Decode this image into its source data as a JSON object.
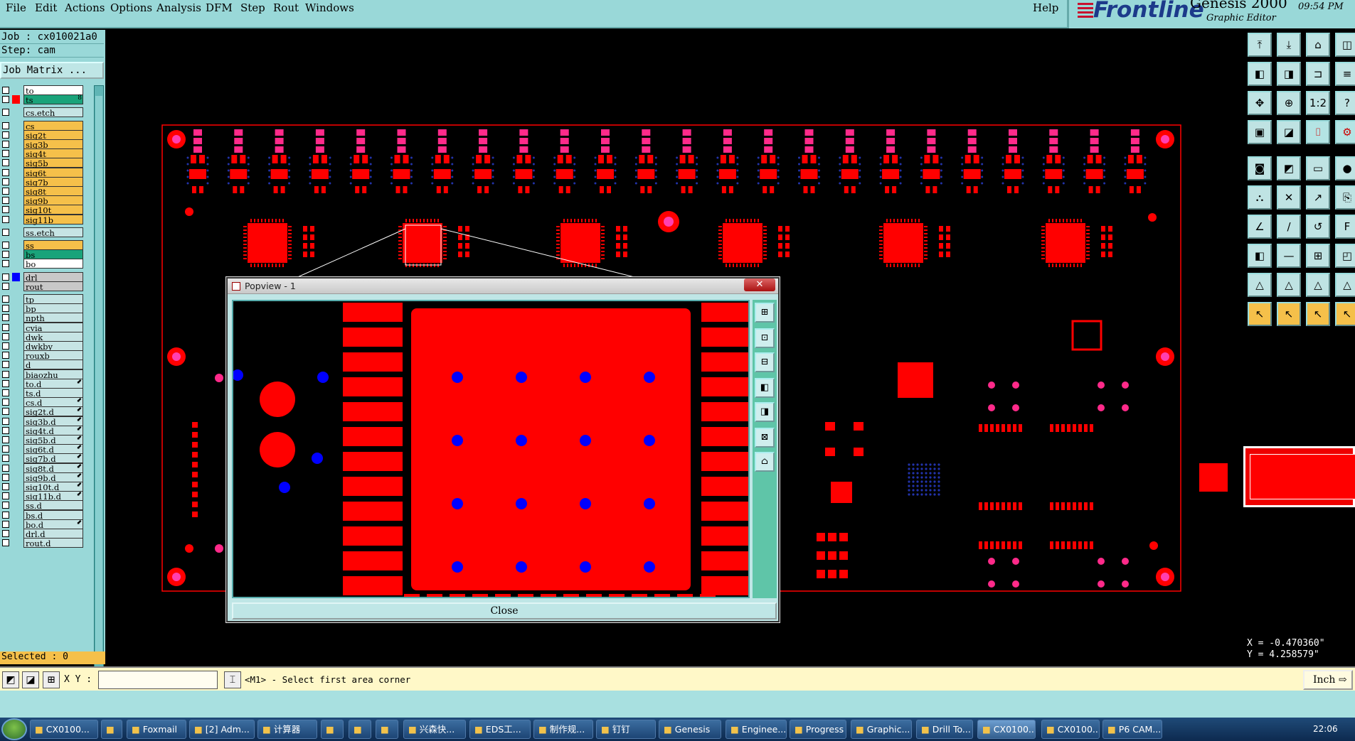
{
  "menu": [
    "File",
    "Edit",
    "Actions",
    "Options",
    "Analysis",
    "DFM",
    "Step",
    "Rout",
    "Windows"
  ],
  "help": "Help",
  "brand": {
    "logo": "Frontline",
    "title": "Genesis 2000",
    "subtitle": "Graphic Editor",
    "time": "09:54 PM"
  },
  "job": {
    "label": "Job : cx010021a0",
    "step": "Step: cam",
    "matrix_button": "Job Matrix ..."
  },
  "layers": [
    {
      "name": "to",
      "color": "#ffffff",
      "dot": "",
      "sub": ""
    },
    {
      "name": "ts",
      "color": "#1aa37a",
      "dot": "#ff0000",
      "sub": "8"
    },
    {
      "name": "cs.etch",
      "color": "#c6e4e4",
      "dot": "",
      "sub": ""
    },
    {
      "name": "cs",
      "color": "#f5c04a",
      "dot": "",
      "sub": ""
    },
    {
      "name": "sig2t",
      "color": "#f5c04a",
      "dot": "",
      "sub": ""
    },
    {
      "name": "sig3b",
      "color": "#f5c04a",
      "dot": "",
      "sub": ""
    },
    {
      "name": "sig4t",
      "color": "#f5c04a",
      "dot": "",
      "sub": ""
    },
    {
      "name": "sig5b",
      "color": "#f5c04a",
      "dot": "",
      "sub": ""
    },
    {
      "name": "sig6t",
      "color": "#f5c04a",
      "dot": "",
      "sub": ""
    },
    {
      "name": "sig7b",
      "color": "#f5c04a",
      "dot": "",
      "sub": ""
    },
    {
      "name": "sig8t",
      "color": "#f5c04a",
      "dot": "",
      "sub": ""
    },
    {
      "name": "sig9b",
      "color": "#f5c04a",
      "dot": "",
      "sub": ""
    },
    {
      "name": "sig10t",
      "color": "#f5c04a",
      "dot": "",
      "sub": ""
    },
    {
      "name": "sig11b",
      "color": "#f5c04a",
      "dot": "",
      "sub": ""
    },
    {
      "name": "ss.etch",
      "color": "#c6e4e4",
      "dot": "",
      "sub": ""
    },
    {
      "name": "ss",
      "color": "#f5c04a",
      "dot": "",
      "sub": ""
    },
    {
      "name": "bs",
      "color": "#1aa37a",
      "dot": "",
      "sub": ""
    },
    {
      "name": "bo",
      "color": "#ffffff",
      "dot": "",
      "sub": ""
    },
    {
      "name": "drl",
      "color": "#c8c8c8",
      "dot": "#0000ff",
      "sub": ""
    },
    {
      "name": "rout",
      "color": "#c8c8c8",
      "dot": "",
      "sub": ""
    },
    {
      "name": "tp",
      "color": "#c6e4e4",
      "dot": "",
      "sub": ""
    },
    {
      "name": "bp",
      "color": "#c6e4e4",
      "dot": "",
      "sub": ""
    },
    {
      "name": "npth",
      "color": "#c6e4e4",
      "dot": "",
      "sub": ""
    },
    {
      "name": "cvia",
      "color": "#c6e4e4",
      "dot": "",
      "sub": ""
    },
    {
      "name": "dwk",
      "color": "#c6e4e4",
      "dot": "",
      "sub": ""
    },
    {
      "name": "dwkby",
      "color": "#c6e4e4",
      "dot": "",
      "sub": ""
    },
    {
      "name": "rouxb",
      "color": "#c6e4e4",
      "dot": "",
      "sub": ""
    },
    {
      "name": "d",
      "color": "#c6e4e4",
      "dot": "",
      "sub": ""
    },
    {
      "name": "biaozhu",
      "color": "#c6e4e4",
      "dot": "",
      "sub": ""
    },
    {
      "name": "to.d",
      "color": "#c6e4e4",
      "dot": "",
      "sub": "⬋"
    },
    {
      "name": "ts.d",
      "color": "#c6e4e4",
      "dot": "",
      "sub": ""
    },
    {
      "name": "cs.d",
      "color": "#c6e4e4",
      "dot": "",
      "sub": "⬋"
    },
    {
      "name": "sig2t.d",
      "color": "#c6e4e4",
      "dot": "",
      "sub": "⬋"
    },
    {
      "name": "sig3b.d",
      "color": "#c6e4e4",
      "dot": "",
      "sub": "⬋"
    },
    {
      "name": "sig4t.d",
      "color": "#c6e4e4",
      "dot": "",
      "sub": "⬋"
    },
    {
      "name": "sig5b.d",
      "color": "#c6e4e4",
      "dot": "",
      "sub": "⬋"
    },
    {
      "name": "sig6t.d",
      "color": "#c6e4e4",
      "dot": "",
      "sub": "⬋"
    },
    {
      "name": "sig7b.d",
      "color": "#c6e4e4",
      "dot": "",
      "sub": "⬋"
    },
    {
      "name": "sig8t.d",
      "color": "#c6e4e4",
      "dot": "",
      "sub": "⬋"
    },
    {
      "name": "sig9b.d",
      "color": "#c6e4e4",
      "dot": "",
      "sub": "⬋"
    },
    {
      "name": "sig10t.d",
      "color": "#c6e4e4",
      "dot": "",
      "sub": "⬋"
    },
    {
      "name": "sig11b.d",
      "color": "#c6e4e4",
      "dot": "",
      "sub": "⬋"
    },
    {
      "name": "ss.d",
      "color": "#c6e4e4",
      "dot": "",
      "sub": ""
    },
    {
      "name": "bs.d",
      "color": "#c6e4e4",
      "dot": "",
      "sub": ""
    },
    {
      "name": "bo.d",
      "color": "#c6e4e4",
      "dot": "",
      "sub": "⬋"
    },
    {
      "name": "drl.d",
      "color": "#c6e4e4",
      "dot": "",
      "sub": ""
    },
    {
      "name": "rout.d",
      "color": "#c6e4e4",
      "dot": "",
      "sub": ""
    }
  ],
  "selected": "Selected : 0",
  "coords": {
    "x": "X = -0.470360\"",
    "y": "Y = 4.258579\""
  },
  "status": {
    "xy_label": "X Y :",
    "xy_value": "",
    "prompt": "<M1> - Select first area corner",
    "units": "Inch"
  },
  "popview": {
    "title": "Popview - 1",
    "close_x": "✕",
    "close_button": "Close"
  },
  "taskbar": [
    {
      "label": "CX0100...",
      "icon": "ie-icon"
    },
    {
      "label": "",
      "icon": "folder-icon"
    },
    {
      "label": "Foxmail",
      "icon": "foxmail-icon"
    },
    {
      "label": "[2] Adm...",
      "icon": "admin-icon"
    },
    {
      "label": "计算器",
      "icon": "calculator-icon"
    },
    {
      "label": "",
      "icon": "app-icon"
    },
    {
      "label": "",
      "icon": "app-icon"
    },
    {
      "label": "",
      "icon": "app-icon"
    },
    {
      "label": "兴森快...",
      "icon": "star-icon"
    },
    {
      "label": "EDS工...",
      "icon": "eds-icon"
    },
    {
      "label": "制作规...",
      "icon": "doc-icon"
    },
    {
      "label": "钉钉",
      "icon": "dingtalk-icon"
    },
    {
      "label": "Genesis",
      "icon": "genesis-icon"
    },
    {
      "label": "Enginee...",
      "icon": "window-icon"
    },
    {
      "label": "Progress",
      "icon": "window-icon"
    },
    {
      "label": "Graphic...",
      "icon": "window-icon"
    },
    {
      "label": "Drill To...",
      "icon": "window-icon"
    },
    {
      "label": "CX0100...",
      "icon": "window-icon"
    },
    {
      "label": "CX0100...",
      "icon": "window-icon"
    },
    {
      "label": "P6 CAM...",
      "icon": "window-icon"
    }
  ],
  "clock": "22:06",
  "colors": {
    "pad": "#ff0000",
    "drill": "#0000ff",
    "panel": "#99d8d8",
    "background": "#000000"
  },
  "toolbar_icons": [
    "top-view-icon",
    "bottom-view-icon",
    "home-icon",
    "panel-icon",
    "left-icon",
    "right-icon",
    "undo-icon",
    "list-icon",
    "fit-icon",
    "zoom-icon",
    "scale-icon",
    "help-icon",
    "display-icon",
    "snap-icon",
    "rule-icon",
    "filter-icon",
    "select-icon",
    "route-icon",
    "measure-icon",
    "point-icon",
    "net-icon",
    "cut-icon",
    "move-icon",
    "copy-icon",
    "line-icon",
    "slash-icon",
    "arc-icon",
    "text-icon",
    "pad-icon",
    "minus-icon",
    "grid-icon",
    "feature-icon",
    "tri-icon",
    "tri-a-icon",
    "tri-b-icon",
    "tri-c-icon",
    "pointer-icon",
    "pointer-b-icon",
    "pointer-c-icon",
    "pointer-d-icon"
  ]
}
